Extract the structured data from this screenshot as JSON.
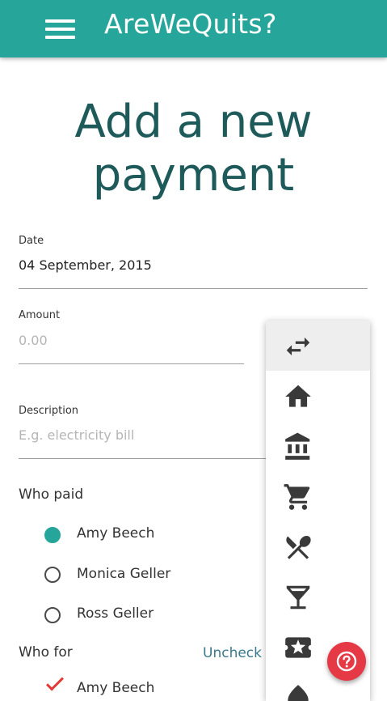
{
  "app": {
    "title": "AreWeQuits?"
  },
  "page": {
    "title": "Add a new payment"
  },
  "form": {
    "date": {
      "label": "Date",
      "value": "04 September, 2015"
    },
    "amount": {
      "label": "Amount",
      "placeholder": "0.00"
    },
    "description": {
      "label": "Description",
      "placeholder": "E.g. electricity bill"
    },
    "who_paid": {
      "label": "Who paid",
      "options": [
        "Amy Beech",
        "Monica Geller",
        "Ross Geller"
      ],
      "selected": "Amy Beech"
    },
    "who_for": {
      "label": "Who for",
      "action": "Uncheck a",
      "first_row": "Amy Beech"
    }
  },
  "category_menu": {
    "selected": "transfer",
    "icons": [
      "transfer-icon",
      "home-icon",
      "bank-icon",
      "cart-icon",
      "food-icon",
      "drinks-icon",
      "ticket-icon",
      "water-icon"
    ]
  },
  "help_button": {
    "icon": "help-icon",
    "color": "#e53945"
  },
  "colors": {
    "primary": "#26a69a",
    "title": "#1e5a5a",
    "accent": "#e53945"
  }
}
